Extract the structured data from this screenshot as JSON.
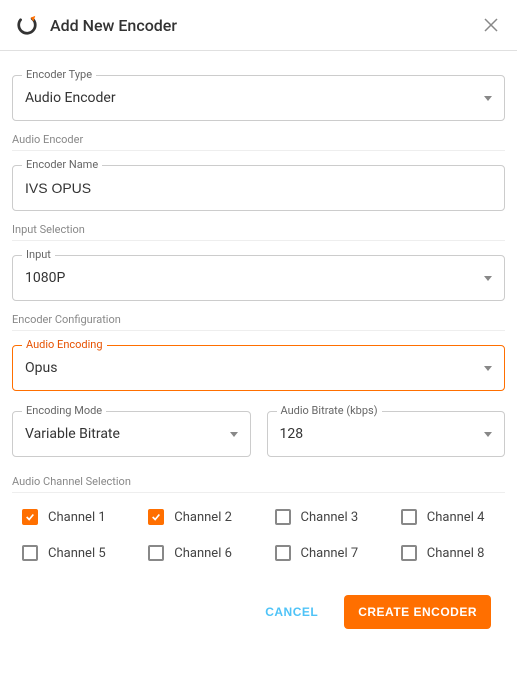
{
  "modal": {
    "title": "Add New Encoder",
    "cancel_label": "Cancel",
    "submit_label": "Create Encoder"
  },
  "encoder_type": {
    "label": "Encoder Type",
    "value": "Audio Encoder"
  },
  "sections": {
    "audio_encoder": "Audio Encoder",
    "input_selection": "Input Selection",
    "encoder_config": "Encoder Configuration",
    "channel_selection": "Audio Channel Selection"
  },
  "encoder_name": {
    "label": "Encoder Name",
    "value": "IVS OPUS"
  },
  "input": {
    "label": "Input",
    "value": "1080P"
  },
  "audio_encoding": {
    "label": "Audio Encoding",
    "value": "Opus"
  },
  "encoding_mode": {
    "label": "Encoding Mode",
    "value": "Variable Bitrate"
  },
  "audio_bitrate": {
    "label": "Audio Bitrate (kbps)",
    "value": "128"
  },
  "channels": [
    {
      "label": "Channel 1",
      "checked": true
    },
    {
      "label": "Channel 2",
      "checked": true
    },
    {
      "label": "Channel 3",
      "checked": false
    },
    {
      "label": "Channel 4",
      "checked": false
    },
    {
      "label": "Channel 5",
      "checked": false
    },
    {
      "label": "Channel 6",
      "checked": false
    },
    {
      "label": "Channel 7",
      "checked": false
    },
    {
      "label": "Channel 8",
      "checked": false
    }
  ],
  "colors": {
    "accent": "#ff6f00",
    "cancel": "#4fc3f7"
  }
}
